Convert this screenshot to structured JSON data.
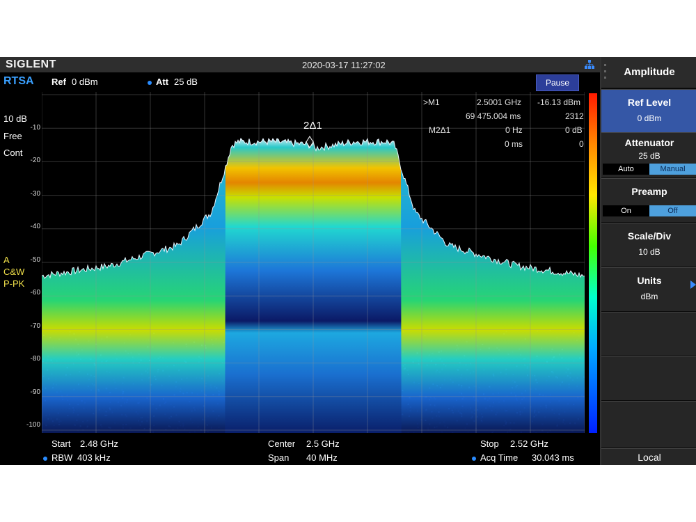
{
  "brand": "SIGLENT",
  "datetime": "2020-03-17 11:27:02",
  "mode": "RTSA",
  "ref": {
    "label": "Ref",
    "value": "0 dBm"
  },
  "att": {
    "label": "Att",
    "value": "25 dB"
  },
  "pause_button": "Pause",
  "left_panel": {
    "scale": "10 dB",
    "trigger": "Free",
    "sweep": "Cont",
    "trace_letter": "A",
    "trace_mode1": "C&W",
    "trace_mode2": "P-PK"
  },
  "y_axis_ticks": [
    "-10",
    "-20",
    "-30",
    "-40",
    "-50",
    "-60",
    "-70",
    "-80",
    "-90",
    "-100"
  ],
  "marker_label": "2Δ1",
  "marker_table": {
    "r1": {
      "name": ">M1",
      "freq": "2.5001 GHz",
      "amp": "-16.13 dBm"
    },
    "r2": {
      "freq": "69 475.004 ms",
      "amp": "2312"
    },
    "r3": {
      "name": "M2Δ1",
      "freq": "0 Hz",
      "amp": "0 dB"
    },
    "r4": {
      "freq": "0 ms",
      "amp": "0"
    }
  },
  "bottom": {
    "start_label": "Start",
    "start_value": "2.48 GHz",
    "center_label": "Center",
    "center_value": "2.5 GHz",
    "stop_label": "Stop",
    "stop_value": "2.52 GHz",
    "rbw_label": "RBW",
    "rbw_value": "403 kHz",
    "span_label": "Span",
    "span_value": "40 MHz",
    "acq_label": "Acq Time",
    "acq_value": "30.043 ms"
  },
  "menu": {
    "title": "Amplitude",
    "ref_level": {
      "title": "Ref Level",
      "value": "0 dBm"
    },
    "attenuator": {
      "title": "Attenuator",
      "value": "25 dB",
      "opt1": "Auto",
      "opt2": "Manual",
      "selected": "Manual"
    },
    "preamp": {
      "title": "Preamp",
      "opt1": "On",
      "opt2": "Off",
      "selected": "Off"
    },
    "scale_div": {
      "title": "Scale/Div",
      "value": "10 dB"
    },
    "units": {
      "title": "Units",
      "value": "dBm"
    },
    "local": "Local"
  },
  "colors": {
    "accent": "#3557a6",
    "mode": "#3aa0ff",
    "trace_label": "#f0e04a"
  },
  "chart_data": {
    "type": "area",
    "x_range": [
      2.48,
      2.52
    ],
    "x_unit": "GHz",
    "ylim": [
      -100,
      0
    ],
    "y_unit": "dBm",
    "grid": true,
    "envelope": {
      "x": [
        2.48,
        2.485,
        2.49,
        2.4925,
        2.4935,
        2.494,
        2.4945,
        2.497,
        2.5,
        2.5001,
        2.503,
        2.5055,
        2.506,
        2.5065,
        2.5075,
        2.51,
        2.515,
        2.52
      ],
      "y": [
        -54,
        -51,
        -45,
        -35,
        -22,
        -15,
        -14,
        -14,
        -15,
        -16,
        -14,
        -14,
        -15,
        -22,
        -35,
        -45,
        -51,
        -54
      ]
    }
  }
}
